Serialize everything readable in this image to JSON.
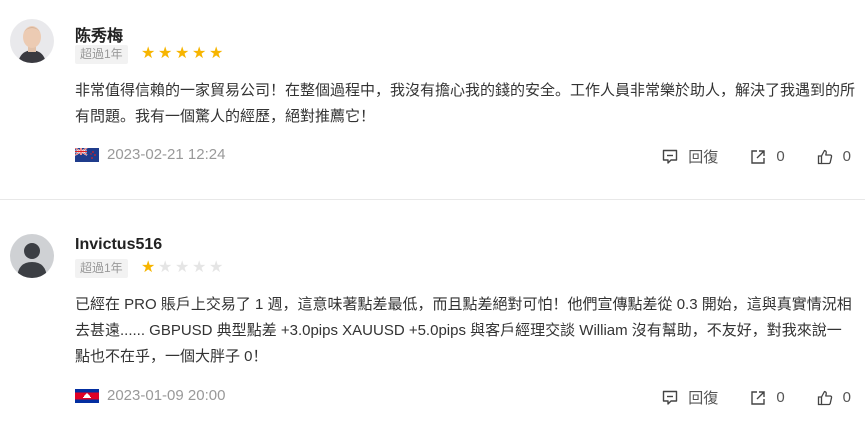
{
  "reviews": [
    {
      "username": "陈秀梅",
      "badge": "超過1年",
      "rating": 5,
      "content": "非常值得信賴的一家貿易公司！在整個過程中，我沒有擔心我的錢的安全。工作人員非常樂於助人，解決了我遇到的所有問題。我有一個驚人的經歷，絕對推薦它！",
      "flag": "new-zealand-flag",
      "date": "2023-02-21 12:24",
      "reply_label": "回復",
      "share_count": "0",
      "like_count": "0"
    },
    {
      "username": "Invictus516",
      "badge": "超過1年",
      "rating": 1,
      "content": "已經在 PRO 賬戶上交易了 1 週，這意味著點差最低，而且點差絕對可怕！他們宣傳點差從 0.3 開始，這與真實情況相去甚遠...... GBPUSD 典型點差 +3.0pips XAUUSD +5.0pips 與客戶經理交談 William 沒有幫助，不友好，對我來說一點也不在乎，一個大胖子 0！",
      "flag": "cambodia-flag",
      "date": "2023-01-09 20:00",
      "reply_label": "回復",
      "share_count": "0",
      "like_count": "0"
    }
  ],
  "colors": {
    "star_on": "#f7b500",
    "star_off": "#e5e5e5",
    "muted": "#999999"
  }
}
